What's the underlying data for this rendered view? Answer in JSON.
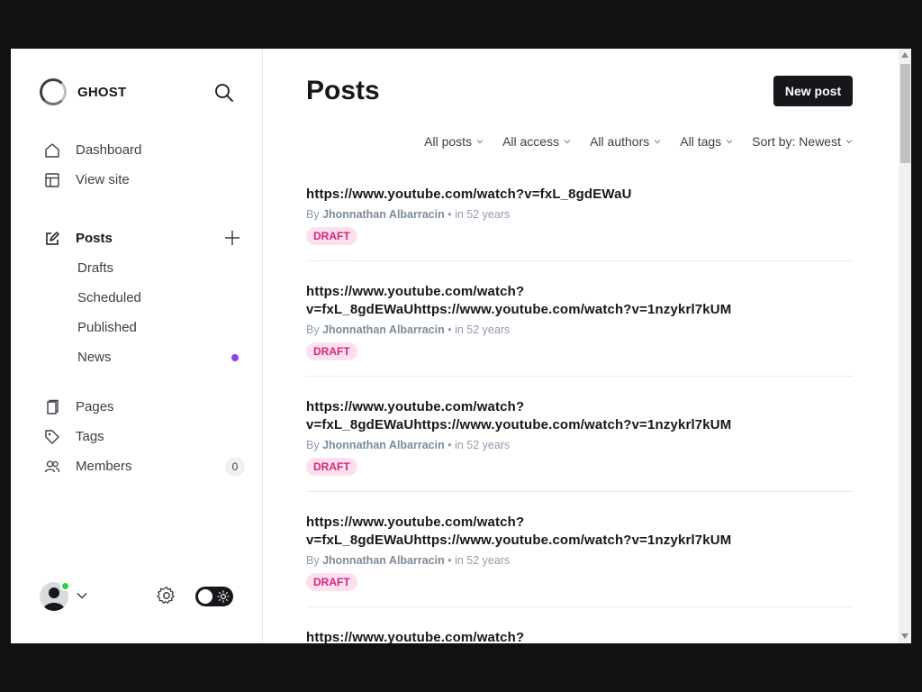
{
  "sidebar": {
    "brand": "GHOST",
    "nav_top": [
      {
        "label": "Dashboard",
        "icon": "home-icon"
      },
      {
        "label": "View site",
        "icon": "layout-icon"
      }
    ],
    "posts": {
      "label": "Posts",
      "icon": "pencil-icon",
      "add_icon": "plus-icon"
    },
    "post_sub": [
      {
        "label": "Drafts"
      },
      {
        "label": "Scheduled"
      },
      {
        "label": "Published"
      },
      {
        "label": "News"
      }
    ],
    "nav_bottom": [
      {
        "label": "Pages",
        "icon": "page-icon"
      },
      {
        "label": "Tags",
        "icon": "tag-icon"
      },
      {
        "label": "Members",
        "icon": "members-icon",
        "count": "0"
      }
    ],
    "news_dot_color": "#8e42ee"
  },
  "main": {
    "title": "Posts",
    "new_post_label": "New post",
    "filters": [
      {
        "label": "All posts"
      },
      {
        "label": "All access"
      },
      {
        "label": "All authors"
      },
      {
        "label": "All tags"
      },
      {
        "label": "Sort by: Newest"
      }
    ],
    "posts": [
      {
        "title": "https://www.youtube.com/watch?v=fxL_8gdEWaU",
        "by": "By",
        "author": "Jhonnathan Albarracin",
        "when": "• in 52 years",
        "status": "DRAFT"
      },
      {
        "title": "https://www.youtube.com/watch?\nv=fxL_8gdEWaUhttps://www.youtube.com/watch?v=1nzykrl7kUM",
        "by": "By",
        "author": "Jhonnathan Albarracin",
        "when": "• in 52 years",
        "status": "DRAFT"
      },
      {
        "title": "https://www.youtube.com/watch?\nv=fxL_8gdEWaUhttps://www.youtube.com/watch?v=1nzykrl7kUM",
        "by": "By",
        "author": "Jhonnathan Albarracin",
        "when": "• in 52 years",
        "status": "DRAFT"
      },
      {
        "title": "https://www.youtube.com/watch?\nv=fxL_8gdEWaUhttps://www.youtube.com/watch?v=1nzykrl7kUM",
        "by": "By",
        "author": "Jhonnathan Albarracin",
        "when": "• in 52 years",
        "status": "DRAFT"
      },
      {
        "title": "https://www.youtube.com/watch?",
        "by": "",
        "author": "",
        "when": "",
        "status": ""
      }
    ]
  },
  "colors": {
    "accent": "#15171a",
    "draft_bg": "#fde0ed",
    "draft_fg": "#d6267d",
    "online": "#30cf43"
  }
}
